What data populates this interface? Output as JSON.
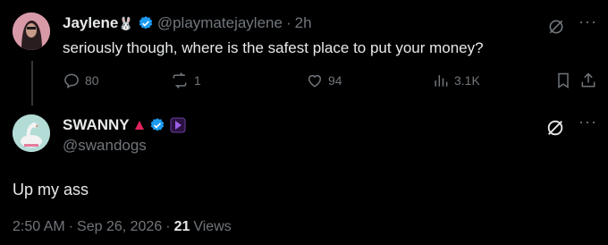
{
  "tweet": {
    "author_name": "Jaylene",
    "author_name_emoji": "🐰",
    "handle": "@playmatejaylene",
    "time_sep": "·",
    "time": "2h",
    "text": "seriously though, where is the safest place to put your money?",
    "replies": "80",
    "reposts": "1",
    "likes": "94",
    "views": "3.1K"
  },
  "reply": {
    "author_name": "SWANNY",
    "handle": "@swandogs",
    "text": "Up my ass",
    "time": "2:50 AM",
    "date": "Sep 26, 2026",
    "sep": "·",
    "views_count": "21",
    "views_label": "Views"
  },
  "colors": {
    "background": "#000000",
    "text_primary": "#e7e9ea",
    "text_secondary": "#71767b",
    "verified_blue": "#1d9bf0",
    "thread_line": "#333639"
  },
  "icons": [
    "verified-badge-icon",
    "grok-icon",
    "more-icon",
    "reply-icon",
    "repost-icon",
    "like-icon",
    "views-icon",
    "bookmark-icon",
    "share-icon",
    "red-triangle-icon",
    "purple-badge-icon"
  ]
}
